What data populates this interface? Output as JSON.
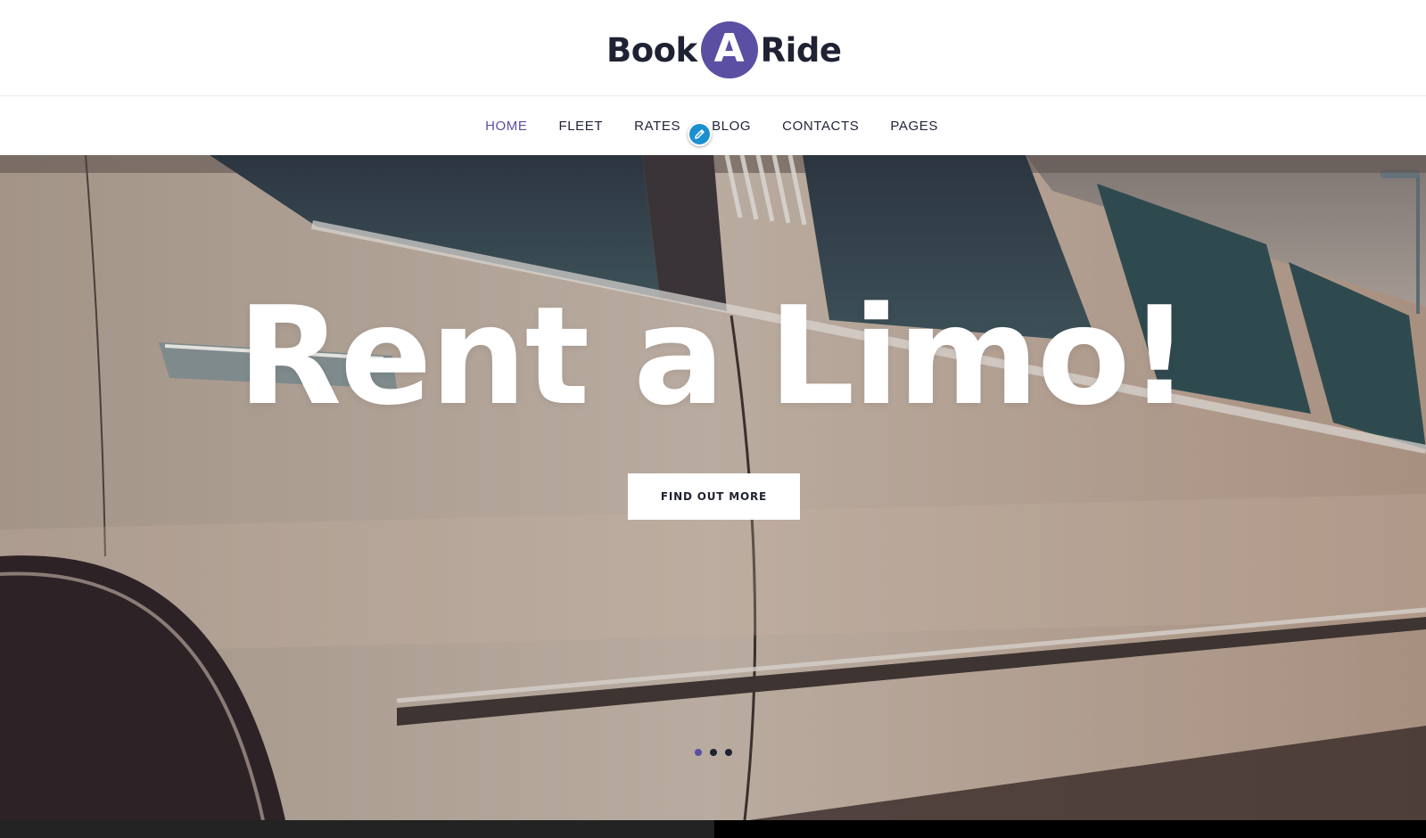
{
  "brand": {
    "word_left": "Book",
    "letter_center": "A",
    "word_right": "Ride",
    "accent_color": "#5b4fa3",
    "icon": "logo-circle-a"
  },
  "nav": {
    "items": [
      {
        "label": "HOME",
        "active": true
      },
      {
        "label": "FLEET",
        "active": false
      },
      {
        "label": "RATES",
        "active": false
      },
      {
        "label": "BLOG",
        "active": false
      },
      {
        "label": "CONTACTS",
        "active": false
      },
      {
        "label": "PAGES",
        "active": false
      }
    ],
    "edit_icon": "pencil-icon",
    "edit_icon_color": "#1b8fd0"
  },
  "hero": {
    "title": "Rent a Limo!",
    "cta_label": "FIND OUT MORE",
    "slides": 3,
    "active_slide": 1,
    "background": "white stretch limousine close-up"
  }
}
